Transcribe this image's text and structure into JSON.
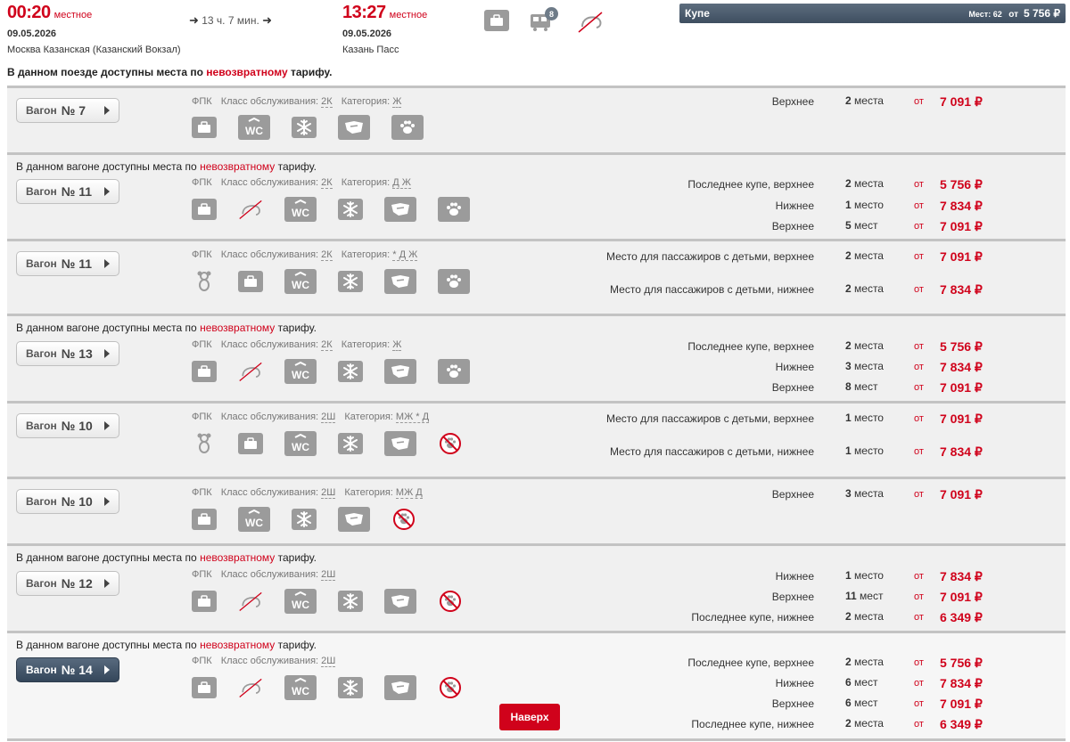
{
  "header": {
    "departure": {
      "time": "00:20",
      "local": "местное",
      "date": "09.05.2026",
      "station": "Москва Казанская (Казанский Вокзал)"
    },
    "duration": "13 ч. 7 мин.",
    "arrival": {
      "time": "13:27",
      "local": "местное",
      "date": "09.05.2026",
      "station": "Казань Пасс"
    },
    "wagons_badge": "8",
    "class_box": {
      "name": "Купе",
      "seats_label": "Мест: 62",
      "from": "от",
      "price": "5 756 ₽"
    },
    "notice_pre": "В данном поезде доступны места по ",
    "notice_red": "невозвратному",
    "notice_post": " тарифу."
  },
  "common": {
    "carrier": "ФПК",
    "service_label": "Класс обслуживания:",
    "category_label": "Категория:",
    "from": "от",
    "car_word": "Вагон",
    "note_pre": "В данном вагоне доступны места по ",
    "note_red": "невозвратному",
    "note_post": " тарифу.",
    "up_button": "Наверх"
  },
  "cars": [
    {
      "num": "№ 7",
      "service": "2К",
      "category": "Ж",
      "rows": [
        {
          "type": "Верхнее",
          "count": "2",
          "unit": " места",
          "price": "7 091 ₽"
        }
      ]
    },
    {
      "num": "№ 11",
      "service": "2К",
      "category": "Д Ж",
      "rows": [
        {
          "type": "Последнее купе, верхнее",
          "count": "2",
          "unit": " места",
          "price": "5 756 ₽"
        },
        {
          "type": "Нижнее",
          "count": "1",
          "unit": " место",
          "price": "7 834 ₽"
        },
        {
          "type": "Верхнее",
          "count": "5",
          "unit": " мест",
          "price": "7 091 ₽"
        }
      ]
    },
    {
      "num": "№ 11",
      "service": "2К",
      "category": "* Д Ж",
      "rows": [
        {
          "type": "Место для пассажиров с детьми, верхнее",
          "count": "2",
          "unit": " места",
          "price": "7 091 ₽"
        },
        {
          "type": "Место для пассажиров с детьми, нижнее",
          "count": "2",
          "unit": " места",
          "price": "7 834 ₽"
        }
      ]
    },
    {
      "num": "№ 13",
      "service": "2К",
      "category": "Ж",
      "rows": [
        {
          "type": "Последнее купе, верхнее",
          "count": "2",
          "unit": " места",
          "price": "5 756 ₽"
        },
        {
          "type": "Нижнее",
          "count": "3",
          "unit": " места",
          "price": "7 834 ₽"
        },
        {
          "type": "Верхнее",
          "count": "8",
          "unit": " мест",
          "price": "7 091 ₽"
        }
      ]
    },
    {
      "num": "№ 10",
      "service": "2Ш",
      "category": "МЖ * Д",
      "rows": [
        {
          "type": "Место для пассажиров с детьми, верхнее",
          "count": "1",
          "unit": " место",
          "price": "7 091 ₽"
        },
        {
          "type": "Место для пассажиров с детьми, нижнее",
          "count": "1",
          "unit": " место",
          "price": "7 834 ₽"
        }
      ]
    },
    {
      "num": "№ 10",
      "service": "2Ш",
      "category": "МЖ Д",
      "rows": [
        {
          "type": "Верхнее",
          "count": "3",
          "unit": " места",
          "price": "7 091 ₽"
        }
      ]
    },
    {
      "num": "№ 12",
      "service": "2Ш",
      "rows": [
        {
          "type": "Нижнее",
          "count": "1",
          "unit": " место",
          "price": "7 834 ₽"
        },
        {
          "type": "Верхнее",
          "count": "11",
          "unit": " мест",
          "price": "7 091 ₽"
        },
        {
          "type": "Последнее купе, нижнее",
          "count": "2",
          "unit": " места",
          "price": "6 349 ₽"
        }
      ]
    },
    {
      "num": "№ 14",
      "service": "2Ш",
      "rows": [
        {
          "type": "Последнее купе, верхнее",
          "count": "2",
          "unit": " места",
          "price": "5 756 ₽"
        },
        {
          "type": "Нижнее",
          "count": "6",
          "unit": " мест",
          "price": "7 834 ₽"
        },
        {
          "type": "Верхнее",
          "count": "6",
          "unit": " мест",
          "price": "7 091 ₽"
        },
        {
          "type": "Последнее купе, нижнее",
          "count": "2",
          "unit": " места",
          "price": "6 349 ₽"
        }
      ]
    }
  ],
  "icons": {
    "bag": "luggage-icon",
    "nofood": "no-food-icon",
    "wc": "wc-icon",
    "ac": "air-conditioning-icon",
    "linen": "bed-linen-icon",
    "pet": "pets-allowed-icon",
    "nopet": "no-pets-icon",
    "child": "child-icon",
    "wagons": "wagons-icon"
  }
}
